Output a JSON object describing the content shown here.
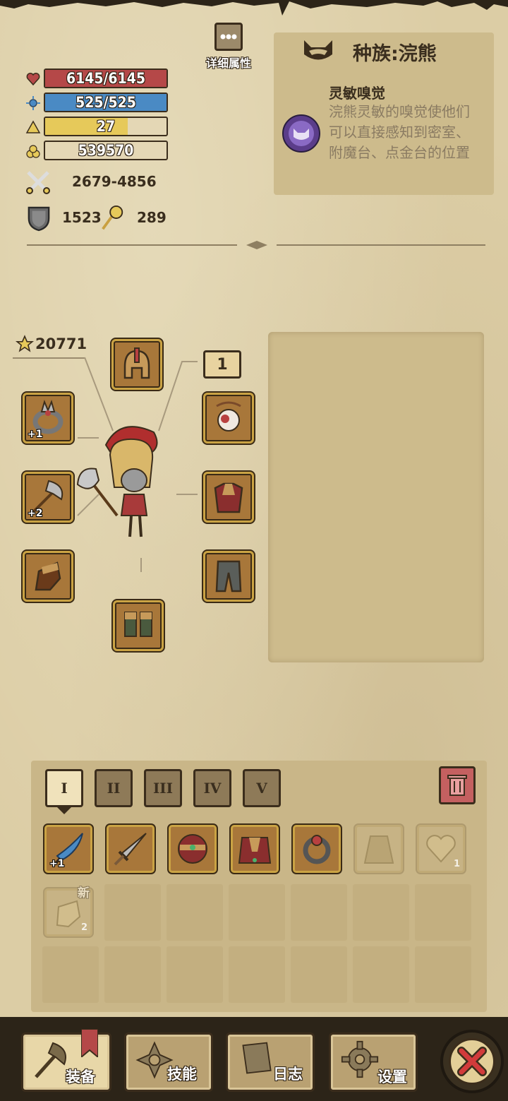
{
  "details_button": {
    "label": "详细属性"
  },
  "stats": {
    "health": "6145/6145",
    "health_ratio": 1.0,
    "mana": "525/525",
    "mana_ratio": 1.0,
    "level": "27",
    "level_ratio": 0.68,
    "gold": "539570",
    "attack": "2679-4856",
    "defense": "1523",
    "magic": "289"
  },
  "race": {
    "title": "种族:浣熊",
    "trait_name": "灵敏嗅觉",
    "trait_desc": "浣熊灵敏的嗅觉使他们可以直接感知到密室、附魔台、点金台的位置"
  },
  "equipment": {
    "power_score": "20771",
    "amulet_count": "1",
    "slots": [
      {
        "id": "helmet",
        "icon": "helmet-icon"
      },
      {
        "id": "ring",
        "icon": "ring-icon",
        "enhance": "+1"
      },
      {
        "id": "amulet",
        "icon": "eye-amulet-icon"
      },
      {
        "id": "weapon",
        "icon": "axe-icon",
        "enhance": "+2"
      },
      {
        "id": "armor",
        "icon": "chest-armor-icon"
      },
      {
        "id": "gloves",
        "icon": "gloves-icon"
      },
      {
        "id": "pants",
        "icon": "pants-icon"
      },
      {
        "id": "boots",
        "icon": "boots-icon"
      }
    ]
  },
  "inventory": {
    "tabs": [
      "I",
      "II",
      "III",
      "IV",
      "V"
    ],
    "active_tab": 0,
    "new_badge": "新",
    "items": [
      {
        "icon": "blue-dagger-icon",
        "enhance": "+1"
      },
      {
        "icon": "sword-icon"
      },
      {
        "icon": "red-helmet-icon"
      },
      {
        "icon": "red-cloak-icon"
      },
      {
        "icon": "ring-icon"
      },
      {
        "icon": "robe-icon",
        "faded": true
      },
      {
        "icon": "heart-icon",
        "count": "1",
        "faded": true
      },
      {
        "icon": "gauntlet-icon",
        "count": "2",
        "faded": true
      }
    ]
  },
  "nav": {
    "equip": "装备",
    "skills": "技能",
    "log": "日志",
    "settings": "设置"
  },
  "colors": {
    "health": "#b54848",
    "mana": "#4a8ac4",
    "level": "#e6c95a",
    "accent_gold": "#caa344",
    "close_red": "#d23b3b"
  }
}
